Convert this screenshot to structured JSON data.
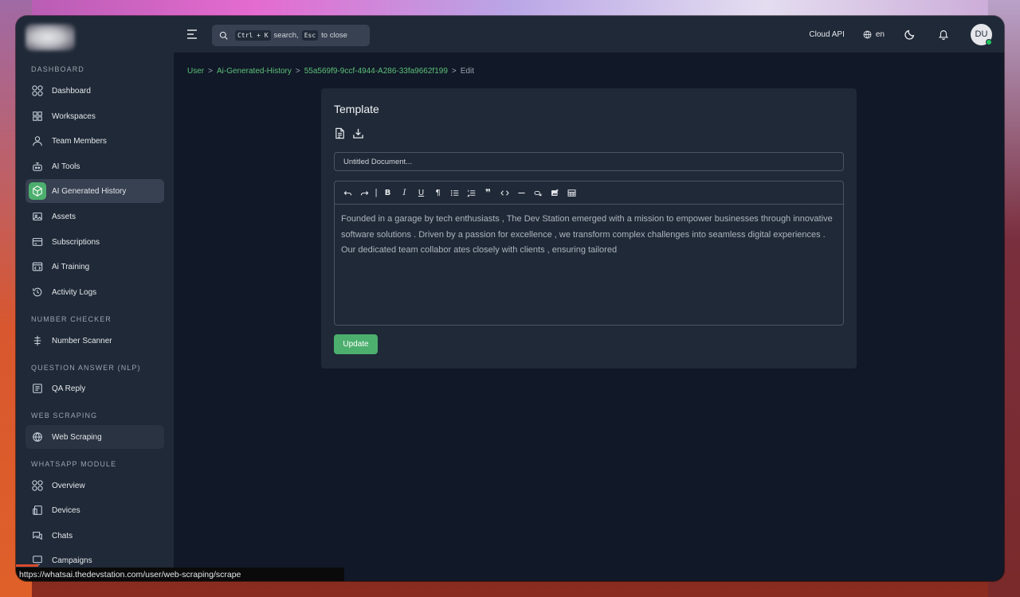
{
  "app": {
    "top_right": {
      "cloud_api": "Cloud API",
      "language": "en",
      "avatar_initials": "DU",
      "accent_color": "#4caf6e"
    }
  },
  "search": {
    "shortcut_key": "Ctrl + K",
    "text_1": "search,",
    "esc_key": "Esc",
    "text_2": "to close"
  },
  "sidebar": {
    "sections": [
      {
        "title": "DASHBOARD",
        "items": [
          {
            "label": "Dashboard",
            "icon": "grid-circles-icon"
          },
          {
            "label": "Workspaces",
            "icon": "grid-squares-icon"
          },
          {
            "label": "Team Members",
            "icon": "user-icon"
          },
          {
            "label": "AI Tools",
            "icon": "robot-icon"
          },
          {
            "label": "AI Generated History",
            "icon": "cube-icon",
            "active": true
          },
          {
            "label": "Assets",
            "icon": "image-icon"
          },
          {
            "label": "Subscriptions",
            "icon": "card-icon"
          },
          {
            "label": "Ai Training",
            "icon": "code-window-icon"
          },
          {
            "label": "Activity Logs",
            "icon": "history-icon"
          }
        ]
      },
      {
        "title": "NUMBER CHECKER",
        "items": [
          {
            "label": "Number Scanner",
            "icon": "scanner-icon"
          }
        ]
      },
      {
        "title": "QUESTION ANSWER (NLP)",
        "items": [
          {
            "label": "QA Reply",
            "icon": "document-icon"
          }
        ]
      },
      {
        "title": "WEB SCRAPING",
        "items": [
          {
            "label": "Web Scraping",
            "icon": "globe-icon"
          }
        ]
      },
      {
        "title": "WHATSAPP MODULE",
        "items": [
          {
            "label": "Overview",
            "icon": "grid-circles-icon"
          },
          {
            "label": "Devices",
            "icon": "devices-icon"
          },
          {
            "label": "Chats",
            "icon": "chat-icon"
          },
          {
            "label": "Campaigns",
            "icon": "monitor-icon"
          }
        ]
      }
    ]
  },
  "breadcrumb": {
    "items": [
      "User",
      "Ai-Generated-History",
      "55a569f9-9ccf-4944-A286-33fa9662f199",
      "Edit"
    ],
    "separator": ">"
  },
  "card": {
    "title": "Template",
    "document_placeholder": "Untitled Document...",
    "editor_text": "Founded in a garage by tech enthusiasts , The Dev Station emerged with a mission to empower businesses through innovative software solutions . Driven by a passion for excellence , we transform complex challenges into seamless digital experiences . Our dedicated team collabor ates closely with clients , ensuring tailored",
    "update_label": "Update"
  },
  "status_url": "https://whatsai.thedevstation.com/user/web-scraping/scrape"
}
